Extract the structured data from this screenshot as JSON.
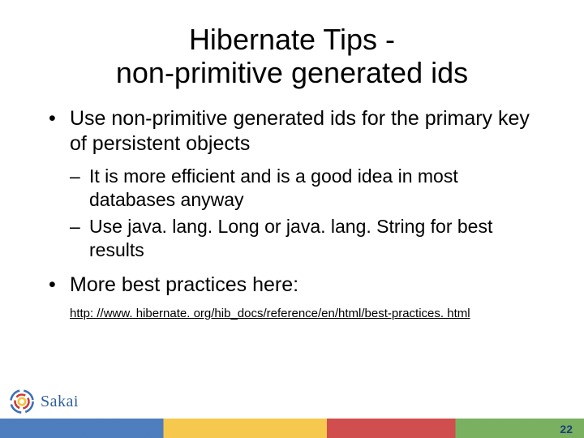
{
  "title_line1": "Hibernate Tips -",
  "title_line2": "non-primitive generated ids",
  "bullets": {
    "b1a": "Use non-primitive generated ids for the primary key of persistent objects",
    "b2a": "It is more efficient and is a good idea in most databases anyway",
    "b2b": "Use java. lang. Long or java. lang. String for best results",
    "b1b": "More best practices here:"
  },
  "link_text": "http: //www. hibernate. org/hib_docs/reference/en/html/best-practices. html",
  "logo_text": "Sakai",
  "page_number": "22"
}
